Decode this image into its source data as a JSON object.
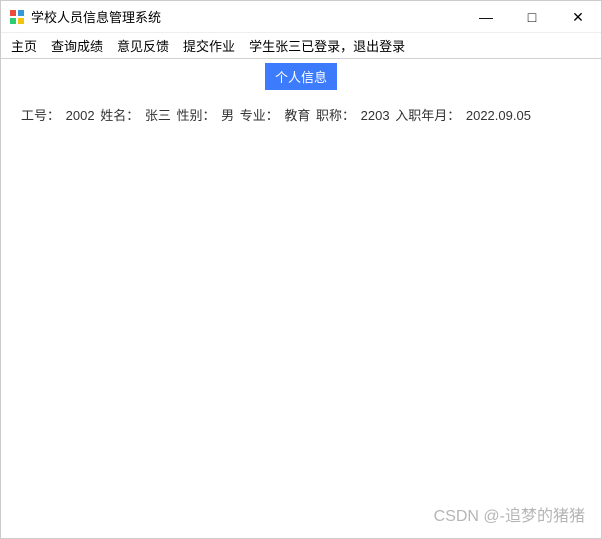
{
  "window": {
    "title": "学校人员信息管理系统"
  },
  "controls": {
    "minimize": "—",
    "maximize": "□",
    "close": "✕"
  },
  "menu": {
    "home": "主页",
    "query": "查询成绩",
    "feedback": "意见反馈",
    "submit": "提交作业",
    "status": "学生张三已登录，退出登录"
  },
  "main": {
    "info_button": "个人信息",
    "fields": {
      "id_label": "工号：",
      "id_value": "2002",
      "name_label": "姓名：",
      "name_value": "张三",
      "gender_label": "性别：",
      "gender_value": "男",
      "major_label": "专业：",
      "major_value": "教育",
      "title_label": "职称：",
      "title_value": "2203",
      "join_label": "入职年月：",
      "join_value": "2022.09.05"
    }
  },
  "watermark": "CSDN @-追梦的猪猪"
}
